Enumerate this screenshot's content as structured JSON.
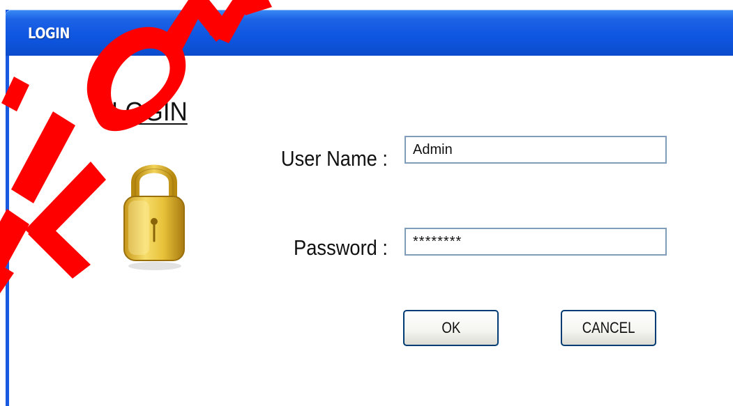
{
  "window": {
    "title": "LOGIN"
  },
  "form": {
    "heading": "LOGIN",
    "username_label": "User Name :",
    "username_value": "Admin",
    "password_label": "Password :",
    "password_value": "********",
    "ok_label": "OK",
    "cancel_label": "CANCEL"
  },
  "icons": {
    "lock": "padlock-icon"
  },
  "colors": {
    "titlebar": "#0e55e0",
    "titlebar_highlight": "#3b8cf5",
    "window_border": "#1a5ae0",
    "input_border": "#7f9db9",
    "button_border": "#003c74",
    "lock_gold": "#e8c23a",
    "watermark": "#ff0000"
  }
}
